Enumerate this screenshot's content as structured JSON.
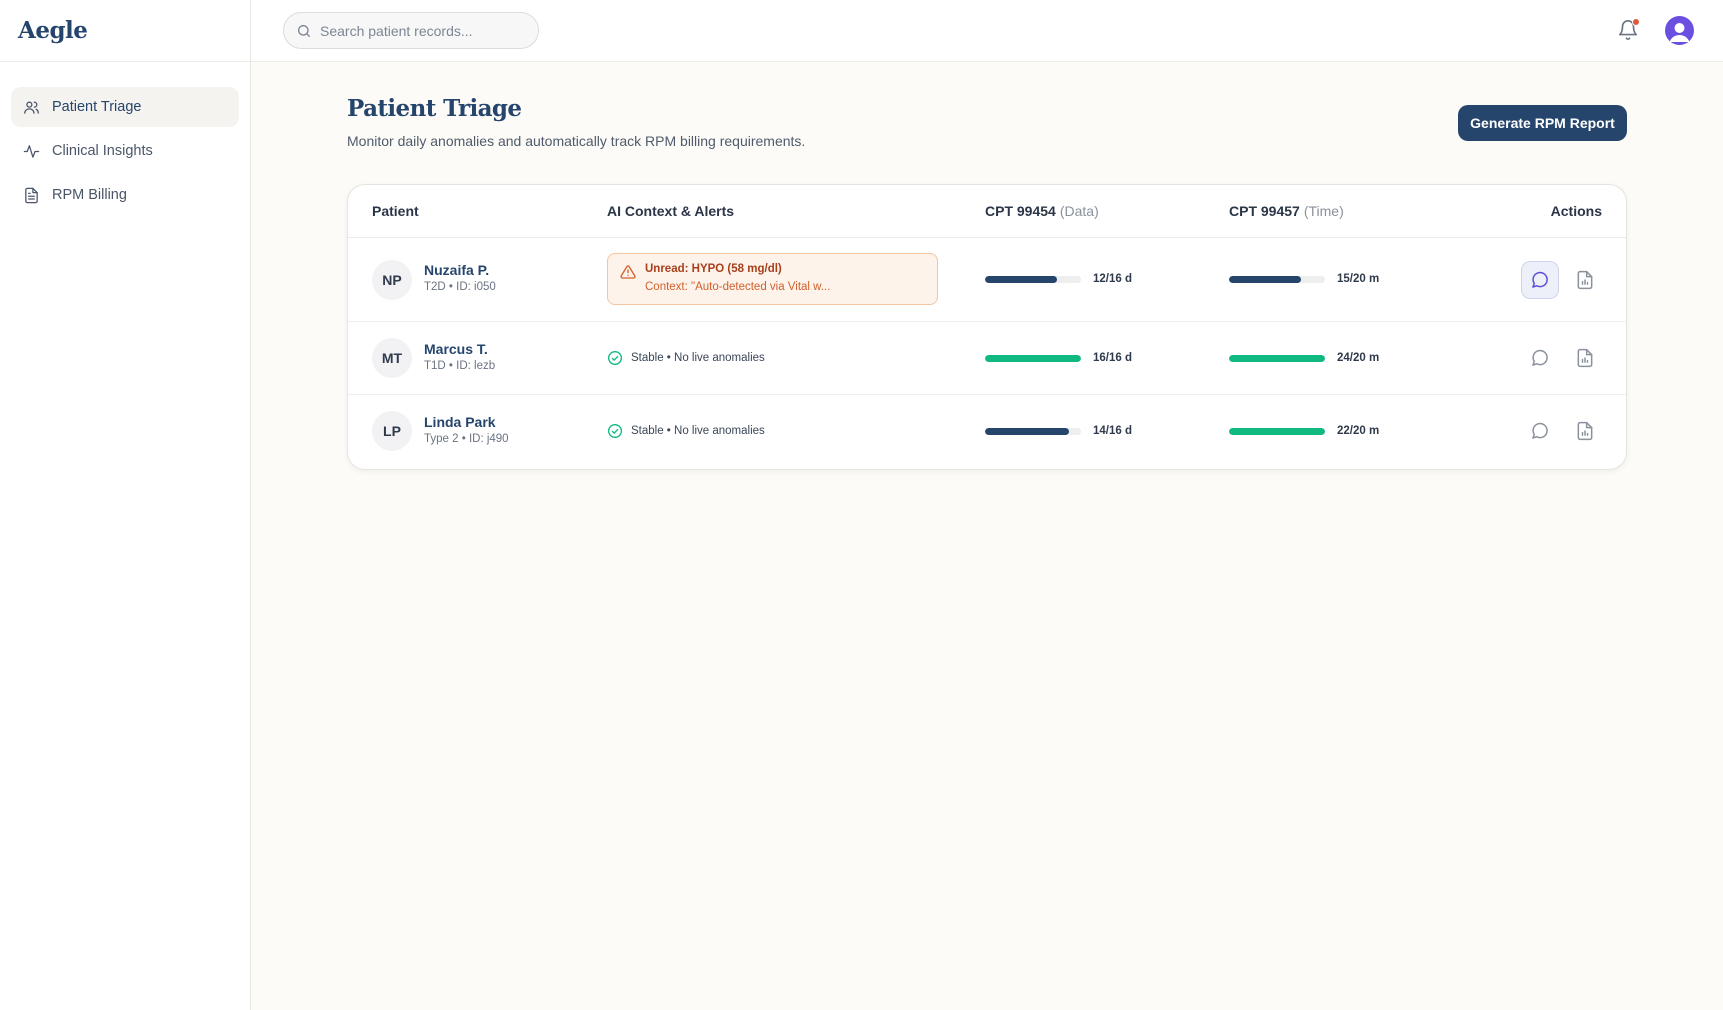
{
  "app": {
    "name": "Aegle"
  },
  "sidebar": {
    "items": [
      {
        "label": "Patient Triage",
        "icon": "users-icon",
        "active": true
      },
      {
        "label": "Clinical Insights",
        "icon": "activity-icon",
        "active": false
      },
      {
        "label": "RPM Billing",
        "icon": "file-text-icon",
        "active": false
      }
    ]
  },
  "topbar": {
    "search_placeholder": "Search patient records...",
    "notification_unread": true
  },
  "page": {
    "title": "Patient Triage",
    "subtitle": "Monitor daily anomalies and automatically track RPM billing requirements.",
    "report_button": "Generate RPM Report"
  },
  "table": {
    "headers": {
      "patient": "Patient",
      "ai": "AI Context & Alerts",
      "cpt1": "CPT 99454",
      "cpt1_sub": "(Data)",
      "cpt2": "CPT 99457",
      "cpt2_sub": "(Time)",
      "actions": "Actions"
    },
    "rows": [
      {
        "initials": "NP",
        "name": "Nuzaifa P.",
        "meta": "T2D • ID: i050",
        "alert": {
          "title": "Unread: HYPO (58 mg/dl)",
          "context": "Context: \"Auto-detected via Vital w..."
        },
        "cpt99454": {
          "label": "12/16 d",
          "progress": 0.75,
          "color": "#26456d"
        },
        "cpt99457": {
          "label": "15/20 m",
          "progress": 0.75,
          "color": "#26456d"
        }
      },
      {
        "initials": "MT",
        "name": "Marcus T.",
        "meta": "T1D • ID: lezb",
        "status": "Stable • No live anomalies",
        "cpt99454": {
          "label": "16/16 d",
          "progress": 1.0,
          "color": "#10b981"
        },
        "cpt99457": {
          "label": "24/20 m",
          "progress": 1.0,
          "color": "#10b981"
        }
      },
      {
        "initials": "LP",
        "name": "Linda Park",
        "meta": "Type 2 • ID: j490",
        "status": "Stable • No live anomalies",
        "cpt99454": {
          "label": "14/16 d",
          "progress": 0.875,
          "color": "#26456d"
        },
        "cpt99457": {
          "label": "22/20 m",
          "progress": 1.0,
          "color": "#10b981"
        }
      }
    ]
  },
  "colors": {
    "primary": "#26456d",
    "success": "#10b981",
    "alert": "#a8401c",
    "notification": "#e3573a",
    "avatar": "#6a4fe0"
  }
}
